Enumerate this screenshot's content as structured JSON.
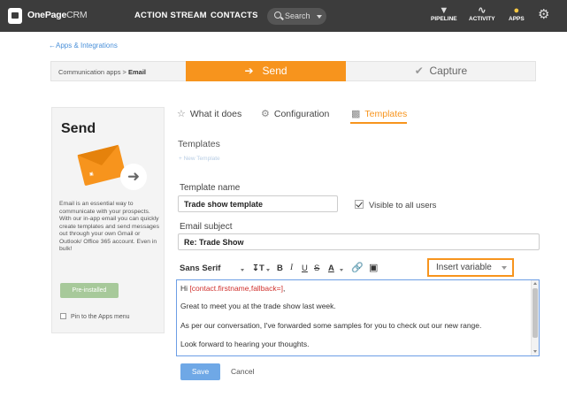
{
  "topbar": {
    "brand_strong": "OnePage",
    "brand_light": "CRM",
    "nav": [
      "ACTION STREAM",
      "CONTACTS"
    ],
    "search_placeholder": "Search",
    "icons": [
      {
        "label": "PIPELINE",
        "icon": "pipeline-icon"
      },
      {
        "label": "ACTIVITY",
        "icon": "activity-icon"
      },
      {
        "label": "APPS",
        "icon": "apps-icon"
      }
    ],
    "settings_icon": "gear-icon"
  },
  "breadcrumb": {
    "back_link": "←Apps & Integrations",
    "crumb_prefix": "Communication apps > ",
    "crumb_current": "Email"
  },
  "steps": {
    "send": "Send",
    "capture": "Capture",
    "active": "Send"
  },
  "app_card": {
    "title": "Send",
    "description": "Email is an essential way to communicate with your prospects. With our in-app email you can quickly create templates and send messages out through your own Gmail or Outlook/ Office 365 account. Even in bulk!",
    "status_button": "Pre-installed",
    "pin_label": "Pin to the Apps menu",
    "pin_checked": false
  },
  "tabs": [
    {
      "label": "What it does",
      "icon": "star-icon"
    },
    {
      "label": "Configuration",
      "icon": "gear-icon"
    },
    {
      "label": "Templates",
      "icon": "folder-icon",
      "active": true
    }
  ],
  "templates": {
    "section_title": "Templates",
    "new_template": "+ New Template",
    "name_label": "Template name",
    "name_value": "Trade show template",
    "visible_label": "Visible to all users",
    "visible_checked": true,
    "subject_label": "Email subject",
    "subject_value": "Re: Trade Show"
  },
  "toolbar": {
    "font": "Sans Serif",
    "size_icon": "font-size-icon",
    "bold": "B",
    "italic": "I",
    "underline": "U",
    "strike": "S",
    "color": "A",
    "link_icon": "link-icon",
    "image_icon": "image-icon",
    "insert_variable": "Insert variable"
  },
  "editor": {
    "greeting": "Hi ",
    "token": "[contact.firstname,fallback=]",
    "greeting_end": ",",
    "lines": [
      "Great to meet you at the trade show last week.",
      "As per our conversation, I've forwarded some samples for you to check out our new range.",
      "Look forward to hearing your thoughts."
    ]
  },
  "actions": {
    "save": "Save",
    "cancel": "Cancel"
  },
  "colors": {
    "accent": "#f7941d",
    "topbar": "#3c3c3c",
    "link": "#4a90d9",
    "save": "#6fa8e6",
    "preinstalled": "#a7c99a",
    "token": "#d0312d"
  }
}
